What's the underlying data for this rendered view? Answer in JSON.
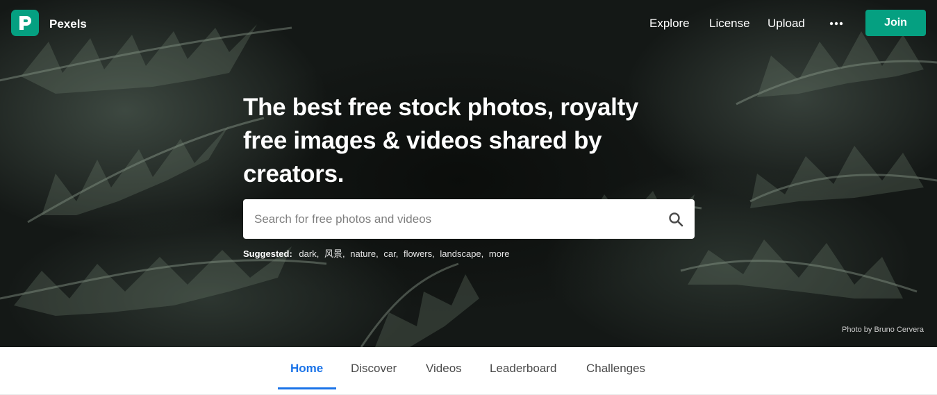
{
  "header": {
    "brand": "Pexels",
    "nav": [
      "Explore",
      "License",
      "Upload"
    ],
    "join_label": "Join",
    "icons": {
      "logo": "pexels-logo-icon",
      "more": "more-dots-icon"
    },
    "accent_color": "#05a081"
  },
  "hero": {
    "headline_lines": [
      "The best free stock photos, royalty",
      "free images & videos shared by",
      "creators."
    ],
    "search": {
      "placeholder": "Search for free photos and videos",
      "value": "",
      "icon": "search-icon"
    },
    "suggested_label": "Suggested:",
    "suggestions": [
      "dark",
      "风景",
      "nature",
      "car",
      "flowers",
      "landscape",
      "more"
    ],
    "credit": "Photo by Bruno Cervera"
  },
  "tabs": {
    "items": [
      "Home",
      "Discover",
      "Videos",
      "Leaderboard",
      "Challenges"
    ],
    "active": "Home",
    "active_color": "#1a73e8"
  }
}
